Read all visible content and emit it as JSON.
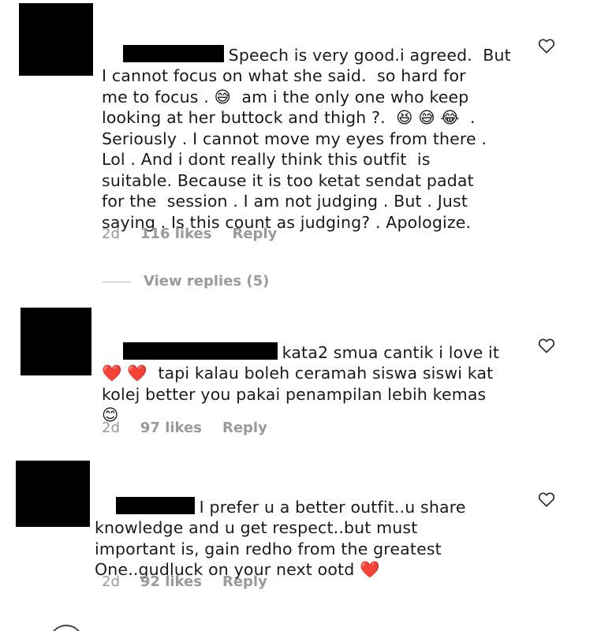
{
  "comments": [
    {
      "text": "Speech is very good.i agreed.  But\nI cannot focus on what she said.  so hard for\nme to focus . 😅  am i the only one who keep\nlooking at her buttock and thigh ?.  😆 😅 😂  .\nSeriously . I cannot move my eyes from there .\nLol . And i dont really think this outfit  is\nsuitable. Because it is too ketat sendat padat\nfor the  session . I am not judging . But . Just\nsaying . Is this count as judging? . Apologize.",
      "age": "2d",
      "likes": "116 likes",
      "reply": "Reply",
      "like_icon": "heart-outline-icon"
    },
    {
      "text": "kata2 smua cantik i love it\n❤️ ❤️  tapi kalau boleh ceramah siswa siswi kat\nkolej better you pakai penampilan lebih kemas\n😊",
      "age": "2d",
      "likes": "97 likes",
      "reply": "Reply",
      "like_icon": "heart-outline-icon"
    },
    {
      "text": "I prefer u a better outfit..u share\nknowledge and u get respect..but must\nimportant is, gain redho from the greatest\nOne..gudluck on your next ootd ❤️",
      "age": "2d",
      "likes": "92 likes",
      "reply": "Reply",
      "like_icon": "heart-outline-icon"
    }
  ],
  "view_replies": "View replies (5)",
  "colors": {
    "text": "#1a1a1a",
    "meta": "#9a9a9a",
    "redaction": "#000000"
  }
}
